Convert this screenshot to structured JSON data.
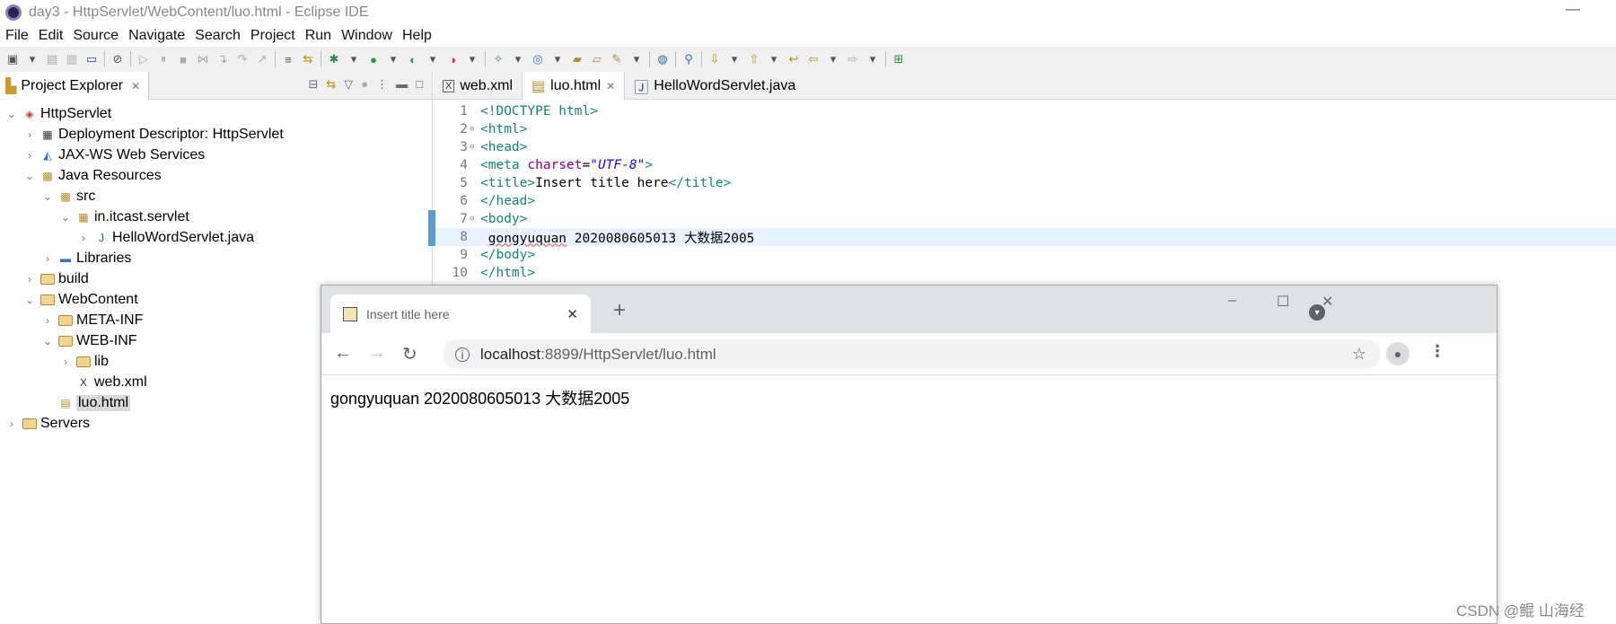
{
  "window": {
    "title": "day3 - HttpServlet/WebContent/luo.html - Eclipse IDE"
  },
  "menu": [
    "File",
    "Edit",
    "Source",
    "Navigate",
    "Search",
    "Project",
    "Run",
    "Window",
    "Help"
  ],
  "explorer": {
    "title": "Project Explorer",
    "tree": [
      {
        "label": "HttpServlet",
        "level": 0,
        "arrow": "open",
        "icon": "web-project-icon"
      },
      {
        "label": "Deployment Descriptor: HttpServlet",
        "level": 1,
        "arrow": "closed",
        "icon": "deployment-descriptor-icon"
      },
      {
        "label": "JAX-WS Web Services",
        "level": 1,
        "arrow": "closed",
        "icon": "web-services-icon"
      },
      {
        "label": "Java Resources",
        "level": 1,
        "arrow": "open",
        "icon": "java-resources-icon"
      },
      {
        "label": "src",
        "level": 2,
        "arrow": "open",
        "icon": "source-folder-icon"
      },
      {
        "label": "in.itcast.servlet",
        "level": 3,
        "arrow": "open",
        "icon": "package-icon"
      },
      {
        "label": "HelloWordServlet.java",
        "level": 4,
        "arrow": "closed",
        "icon": "java-file-icon"
      },
      {
        "label": "Libraries",
        "level": 2,
        "arrow": "closed",
        "icon": "libraries-icon"
      },
      {
        "label": "build",
        "level": 1,
        "arrow": "closed",
        "icon": "folder-icon"
      },
      {
        "label": "WebContent",
        "level": 1,
        "arrow": "open",
        "icon": "folder-icon"
      },
      {
        "label": "META-INF",
        "level": 2,
        "arrow": "closed",
        "icon": "folder-icon"
      },
      {
        "label": "WEB-INF",
        "level": 2,
        "arrow": "open",
        "icon": "folder-icon"
      },
      {
        "label": "lib",
        "level": 3,
        "arrow": "closed",
        "icon": "folder-icon"
      },
      {
        "label": "web.xml",
        "level": 3,
        "arrow": "none",
        "icon": "xml-file-icon"
      },
      {
        "label": "luo.html",
        "level": 2,
        "arrow": "none",
        "icon": "html-file-icon",
        "selected": true
      },
      {
        "label": "Servers",
        "level": 0,
        "arrow": "closed",
        "icon": "folder-icon"
      }
    ]
  },
  "editor": {
    "tabs": [
      {
        "label": "web.xml",
        "active": false
      },
      {
        "label": "luo.html",
        "active": true
      },
      {
        "label": "HelloWordServlet.java",
        "active": false
      }
    ],
    "lines": [
      {
        "n": "1",
        "text": "<!DOCTYPE html>"
      },
      {
        "n": "2",
        "text": "<html>",
        "fold": true
      },
      {
        "n": "3",
        "text": "<head>",
        "fold": true
      },
      {
        "n": "4",
        "text": "<meta charset=\"UTF-8\">"
      },
      {
        "n": "5",
        "text": "<title>Insert title here</title>"
      },
      {
        "n": "6",
        "text": "</head>"
      },
      {
        "n": "7",
        "text": "<body>",
        "fold": true
      },
      {
        "n": "8",
        "text": " gongyuquan 2020080605013 大数据2005",
        "current": true
      },
      {
        "n": "9",
        "text": "</body>"
      },
      {
        "n": "10",
        "text": "</html>"
      }
    ]
  },
  "browser": {
    "tab_title": "Insert title here",
    "url_host": "localhost",
    "url_rest": ":8899/HttpServlet/luo.html",
    "content": "gongyuquan 2020080605013 大数据2005"
  },
  "watermark": "CSDN @鲲  山海经",
  "colors": {
    "tag": "#17817d",
    "attr": "#7f007f",
    "value": "#2a00ff",
    "current_line": "#e8f2fe"
  }
}
